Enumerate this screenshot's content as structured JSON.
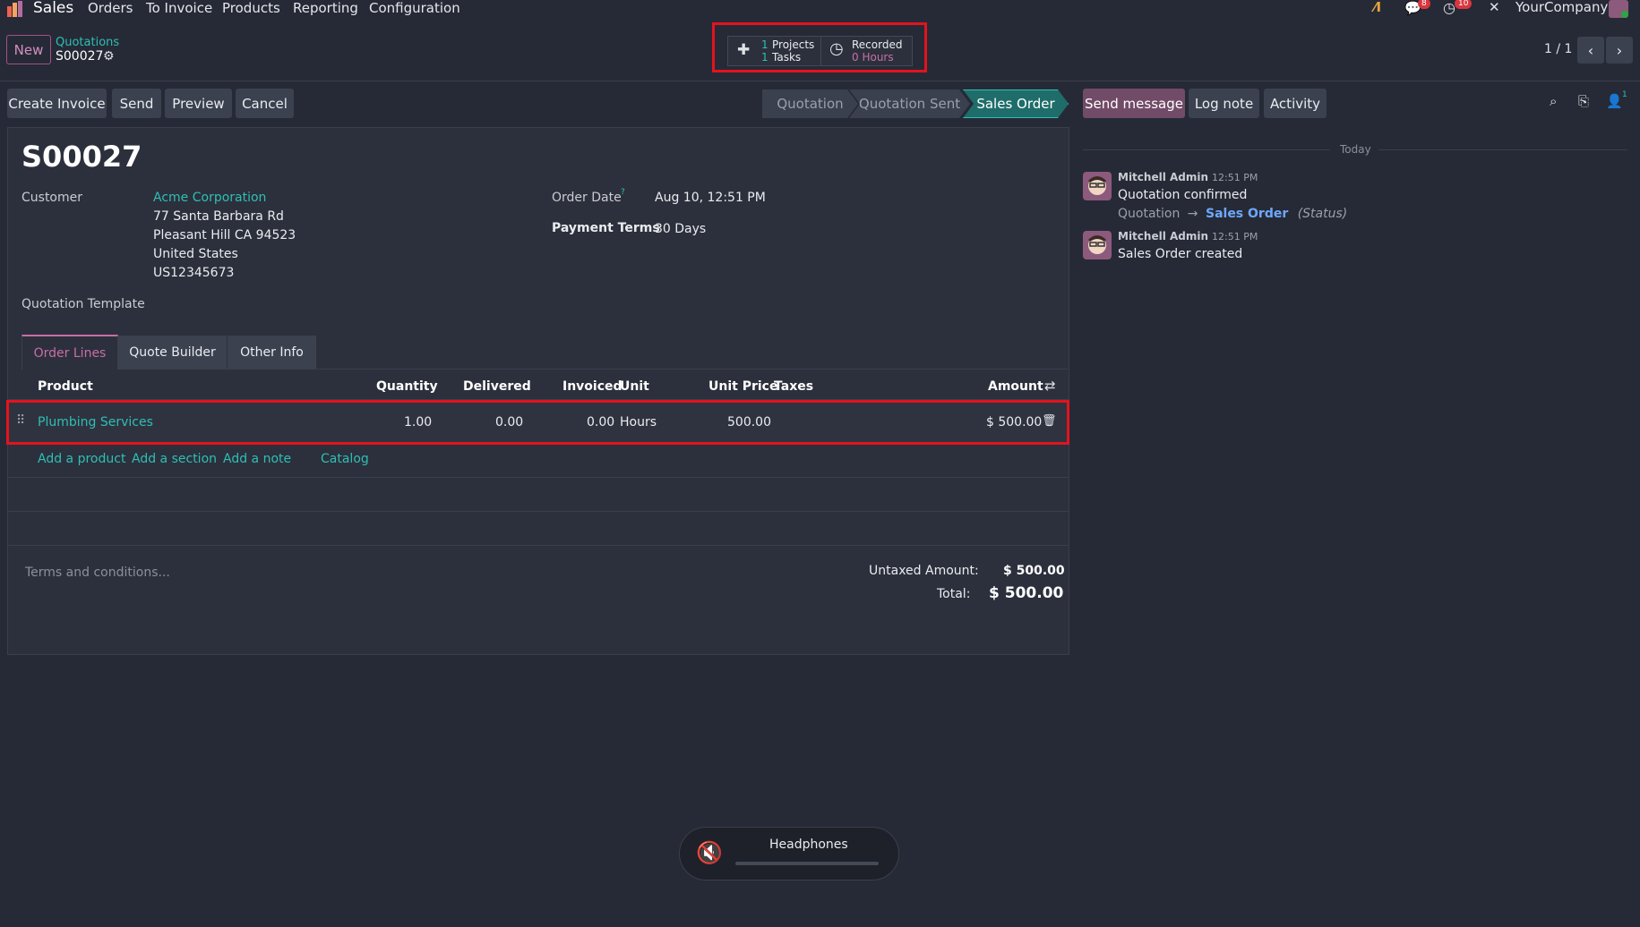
{
  "topnav": {
    "app_name": "Sales",
    "menu": [
      "Orders",
      "To Invoice",
      "Products",
      "Reporting",
      "Configuration"
    ],
    "messages_badge": "8",
    "activities_badge": "10",
    "company": "YourCompany"
  },
  "controlbar": {
    "new_label": "New",
    "breadcrumb_parent": "Quotations",
    "record_name": "S00027",
    "smart_buttons": {
      "projects_count": "1",
      "projects_label": "Projects",
      "tasks_count": "1",
      "tasks_label": "Tasks",
      "recorded_label": "Recorded",
      "recorded_value": "0 Hours"
    },
    "pager": "1 / 1"
  },
  "actions": {
    "create_invoice": "Create Invoice",
    "send": "Send",
    "preview": "Preview",
    "cancel": "Cancel"
  },
  "statusbar": [
    "Quotation",
    "Quotation Sent",
    "Sales Order"
  ],
  "statusbar_current": "Sales Order",
  "form": {
    "title": "S00027",
    "customer_label": "Customer",
    "customer_name": "Acme Corporation",
    "address_lines": [
      "77 Santa Barbara Rd",
      "Pleasant Hill CA 94523",
      "United States",
      "US12345673"
    ],
    "order_date_label": "Order Date",
    "order_date_help": "?",
    "order_date_value": "Aug 10, 12:51 PM",
    "payment_terms_label": "Payment Terms",
    "payment_terms_value": "30 Days",
    "quotation_template_label": "Quotation Template",
    "tabs": [
      "Order Lines",
      "Quote Builder",
      "Other Info"
    ],
    "columns": {
      "product": "Product",
      "quantity": "Quantity",
      "delivered": "Delivered",
      "invoiced": "Invoiced",
      "unit": "Unit",
      "unit_price": "Unit Price",
      "taxes": "Taxes",
      "amount": "Amount"
    },
    "line": {
      "product": "Plumbing Services",
      "quantity": "1.00",
      "delivered": "0.00",
      "invoiced": "0.00",
      "unit": "Hours",
      "unit_price": "500.00",
      "taxes": "",
      "amount": "$ 500.00"
    },
    "add_links": [
      "Add a product",
      "Add a section",
      "Add a note",
      "Catalog"
    ],
    "terms_placeholder": "Terms and conditions...",
    "untaxed_label": "Untaxed Amount:",
    "untaxed_value": "$ 500.00",
    "total_label": "Total:",
    "total_value": "$ 500.00"
  },
  "chatter": {
    "send_message": "Send message",
    "log_note": "Log note",
    "activity": "Activity",
    "followers_count": "1",
    "date_separator": "Today",
    "messages": [
      {
        "author": "Mitchell Admin",
        "time": "12:51 PM",
        "body": "Quotation confirmed",
        "tracking_old": "Quotation",
        "tracking_new": "Sales Order",
        "tracking_field": "(Status)"
      },
      {
        "author": "Mitchell Admin",
        "time": "12:51 PM",
        "body": "Sales Order created"
      }
    ]
  },
  "toast": {
    "label": "Headphones"
  },
  "colors": {
    "background": "#262a36",
    "accent": "#2ebfb5",
    "primary": "#714b67",
    "highlight": "#e3131e"
  }
}
